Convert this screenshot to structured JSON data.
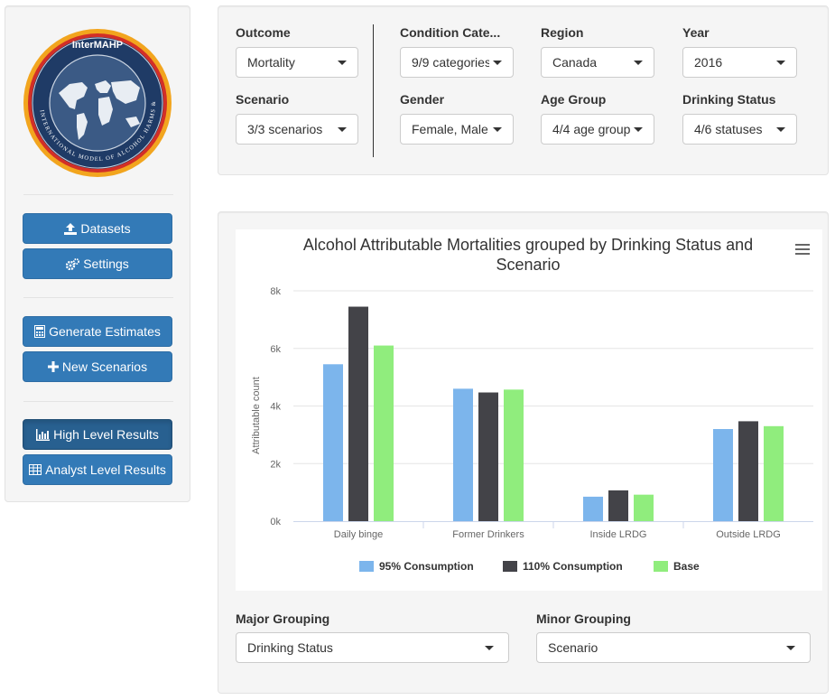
{
  "sidebar": {
    "logo": {
      "title": "InterMAHP",
      "ring_text": "INTERNATIONAL MODEL OF ALCOHOL HARMS & POLICIES"
    },
    "buttons": [
      {
        "label": "Datasets",
        "icon": "upload-icon"
      },
      {
        "label": "Settings",
        "icon": "gears-icon"
      },
      {
        "label": "Generate Estimates",
        "icon": "calculator-icon"
      },
      {
        "label": "New Scenarios",
        "icon": "plus-icon"
      },
      {
        "label": "High Level Results",
        "icon": "bar-chart-icon",
        "active": true
      },
      {
        "label": "Analyst Level Results",
        "icon": "table-icon"
      }
    ]
  },
  "filters": {
    "outcome": {
      "label": "Outcome",
      "value": "Mortality"
    },
    "scenario": {
      "label": "Scenario",
      "value": "3/3 scenarios"
    },
    "condition": {
      "label": "Condition Cate...",
      "value": "9/9 categories"
    },
    "gender": {
      "label": "Gender",
      "value": "Female, Male"
    },
    "region": {
      "label": "Region",
      "value": "Canada"
    },
    "age": {
      "label": "Age Group",
      "value": "4/4 age groups"
    },
    "year": {
      "label": "Year",
      "value": "2016"
    },
    "drinking": {
      "label": "Drinking Status",
      "value": "4/6 statuses"
    }
  },
  "chart_data": {
    "type": "bar",
    "title": "Alcohol Attributable Mortalities grouped by Drinking Status and Scenario",
    "title_lines": [
      "Alcohol Attributable Mortalities grouped by Drinking Status and",
      "Scenario"
    ],
    "ylabel": "Attributable count",
    "xlabel": "",
    "categories": [
      "Daily binge",
      "Former Drinkers",
      "Inside LRDG",
      "Outside LRDG"
    ],
    "ylim": [
      0,
      8000
    ],
    "yticks": [
      0,
      2000,
      4000,
      6000,
      8000
    ],
    "ytick_labels": [
      "0k",
      "2k",
      "4k",
      "6k",
      "8k"
    ],
    "series": [
      {
        "name": "95% Consumption",
        "color": "#7cb5ec",
        "values": [
          5450,
          4600,
          850,
          3200
        ]
      },
      {
        "name": "110% Consumption",
        "color": "#434348",
        "values": [
          7450,
          4470,
          1070,
          3470
        ]
      },
      {
        "name": "Base",
        "color": "#90ed7d",
        "values": [
          6100,
          4570,
          920,
          3300
        ]
      }
    ],
    "grid": true,
    "legend_position": "bottom"
  },
  "grouping": {
    "major": {
      "label": "Major Grouping",
      "value": "Drinking Status"
    },
    "minor": {
      "label": "Minor Grouping",
      "value": "Scenario"
    }
  }
}
